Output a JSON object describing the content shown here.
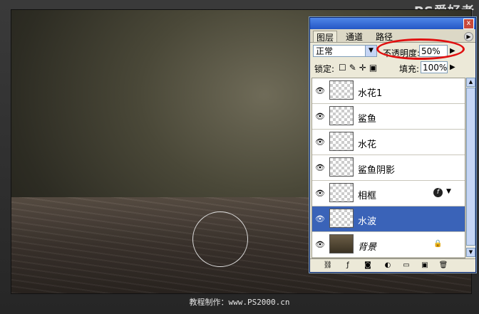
{
  "window": {
    "close_glyph": "x"
  },
  "panel": {
    "tabs": [
      {
        "label": "图层",
        "active": true
      },
      {
        "label": "通道",
        "active": false
      },
      {
        "label": "路径",
        "active": false
      }
    ],
    "blend_mode": "正常",
    "opacity_label": "不透明度:",
    "opacity_value": "50%",
    "lock_label": "锁定:",
    "fill_label": "填充:",
    "fill_value": "100%",
    "layers": [
      {
        "name": "水花1",
        "visible": true,
        "selected": false,
        "icon": "transparent-thumb"
      },
      {
        "name": "鲨鱼",
        "visible": true,
        "selected": false,
        "icon": "transparent-thumb"
      },
      {
        "name": "水花",
        "visible": true,
        "selected": false,
        "icon": "transparent-thumb"
      },
      {
        "name": "鲨鱼阴影",
        "visible": true,
        "selected": false,
        "icon": "transparent-thumb"
      },
      {
        "name": "相框",
        "visible": true,
        "selected": false,
        "icon": "transparent-thumb",
        "has_fx": true
      },
      {
        "name": "水波",
        "visible": true,
        "selected": true,
        "icon": "transparent-thumb"
      },
      {
        "name": "背景",
        "visible": true,
        "selected": false,
        "icon": "background-thumb",
        "locked": true
      }
    ],
    "footer_icons": [
      "link-icon",
      "fx-icon",
      "mask-icon",
      "adjustment-icon",
      "group-folder-icon",
      "new-layer-icon",
      "trash-icon"
    ]
  },
  "watermark": "教程制作：www.PS2000.cn",
  "logo": "PS爱好者"
}
